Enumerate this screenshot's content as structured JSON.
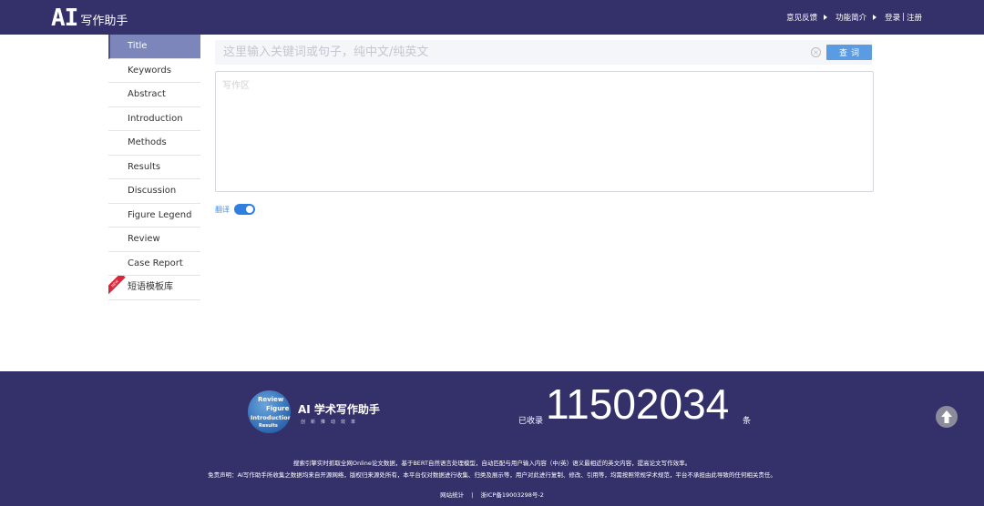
{
  "header": {
    "logo_ai": "AI",
    "logo_text": "写作助手",
    "nav": {
      "feedback": "意见反馈",
      "intro": "功能简介",
      "login": "登录",
      "separator": "|",
      "register": "注册"
    }
  },
  "sidebar": {
    "items": [
      {
        "label": "Title",
        "active": true
      },
      {
        "label": "Keywords"
      },
      {
        "label": "Abstract"
      },
      {
        "label": "Introduction"
      },
      {
        "label": "Methods"
      },
      {
        "label": "Results"
      },
      {
        "label": "Discussion"
      },
      {
        "label": "Figure Legend"
      },
      {
        "label": "Review"
      },
      {
        "label": "Case Report"
      },
      {
        "label": "短语模板库",
        "badge": "NEW"
      }
    ]
  },
  "search": {
    "placeholder": "这里输入关键词或句子，纯中文/纯英文",
    "button": "查词",
    "clear_icon": "clear-circle-icon"
  },
  "editor": {
    "placeholder": "写作区"
  },
  "translate": {
    "label": "翻译",
    "enabled": true
  },
  "footer": {
    "emblem_words": [
      "Review",
      "Figure",
      "Introduction",
      "Results"
    ],
    "brand_title": "AI 学术写作助手",
    "brand_sub": "创新推动效率",
    "count_label": "已收录",
    "count_value": "11502034",
    "count_unit": "条",
    "description_1": "搜索引擎实时抓取全网Online论文数据，基于BERT自然语言处理模型，自动匹配与用户输入内容（中/英）语义最相近的英文内容，提高论文写作效率。",
    "description_2": "免责声明：AI写作助手所收集之数据均来自开源网络，版权归来源处所有，本平台仅对数据进行收集、归类及展示等，用户对此进行复制、修改、引用等，均需按照常规学术规范，平台不承担由此导致的任何相关责任。",
    "stats_link": "网站统计",
    "separator": "|",
    "icp": "浙ICP备19003298号-2",
    "up_icon": "arrow-up-icon"
  },
  "colors": {
    "header_bg": "#34306a",
    "sidebar_active": "#7d86bb",
    "accent": "#5b9be3"
  }
}
